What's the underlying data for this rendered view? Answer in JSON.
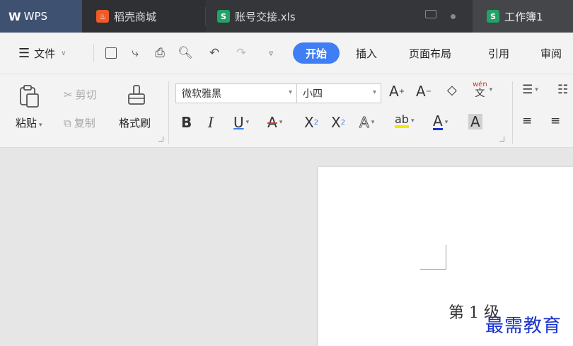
{
  "tabs": {
    "wps_label": "WPS",
    "daoke_label": "稻壳商城",
    "doc1_label": "账号交接.xls",
    "doc2_label": "工作簿1"
  },
  "menu": {
    "file_label": "文件",
    "start_label": "开始",
    "insert_label": "插入",
    "layout_label": "页面布局",
    "reference_label": "引用",
    "review_label": "审阅"
  },
  "ribbon": {
    "paste_label": "粘贴",
    "cut_label": "剪切",
    "copy_label": "复制",
    "format_painter_label": "格式刷",
    "font_name": "微软雅黑",
    "font_size": "小四"
  },
  "document": {
    "heading_text": "第 1 级"
  },
  "watermark": "最需教育",
  "colors": {
    "tab_bar_bg": "#2f3033",
    "wps_tab_bg": "#3e5170",
    "active_tab_bg": "#44464a",
    "start_pill": "#3f7ef5",
    "sheet_green": "#21a366",
    "daoke_orange": "#ef5a2a",
    "watermark_blue": "#1a33cc"
  }
}
